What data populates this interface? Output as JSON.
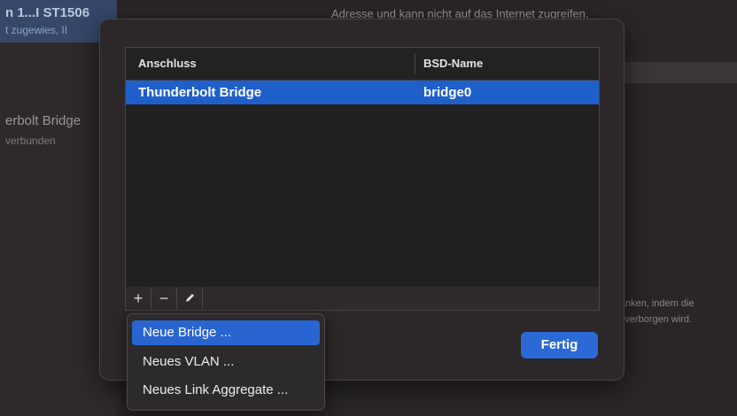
{
  "background": {
    "sidebar_selected_line1": "n 1...I ST1506",
    "sidebar_selected_line2": "t zugewies, II",
    "sidebar_item_name": "erbolt Bridge",
    "sidebar_item_status": "verbunden",
    "top_text": "Adresse und kann nicht auf das Internet zugreifen.",
    "right_text_line1": "hränken, indem die",
    "right_text_line2": "ari verborgen wird."
  },
  "table": {
    "columns": [
      "Anschluss",
      "BSD-Name"
    ],
    "rows": [
      {
        "port": "Thunderbolt Bridge",
        "bsd_name": "bridge0",
        "selected": true
      }
    ]
  },
  "toolbar": {
    "add_symbol": "+",
    "remove_symbol": "−",
    "edit_icon": "pencil-icon"
  },
  "menu": {
    "items": [
      {
        "label": "Neue Bridge ...",
        "highlighted": true
      },
      {
        "label": "Neues VLAN ..."
      },
      {
        "label": "Neues Link Aggregate ..."
      }
    ]
  },
  "buttons": {
    "done": "Fertig"
  },
  "colors": {
    "accent": "#1f5fc9",
    "sheet_bg": "#2c2729"
  }
}
